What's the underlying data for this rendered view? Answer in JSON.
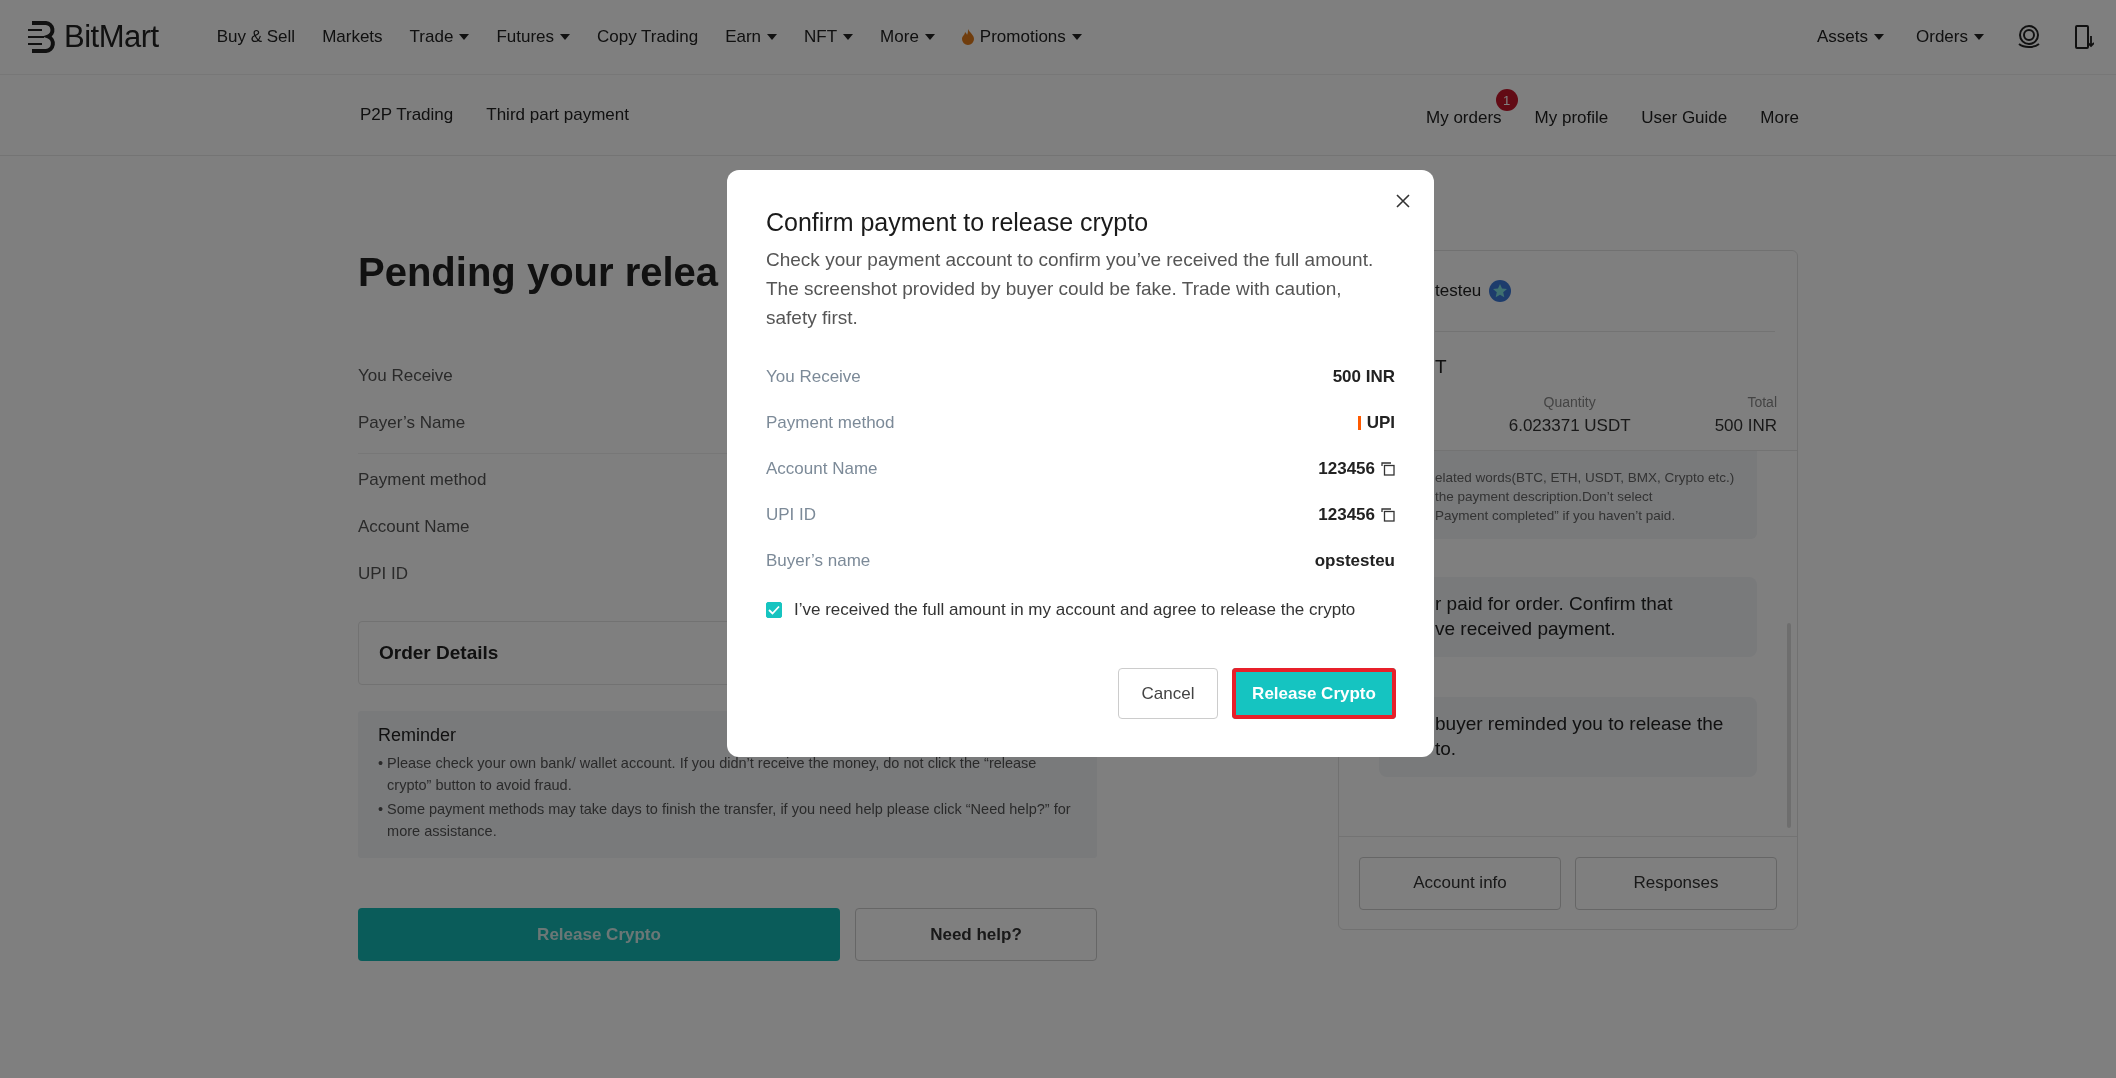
{
  "header": {
    "logo": "BitMart",
    "nav": [
      {
        "label": "Buy & Sell",
        "dropdown": false
      },
      {
        "label": "Markets",
        "dropdown": false
      },
      {
        "label": "Trade",
        "dropdown": true
      },
      {
        "label": "Futures",
        "dropdown": true
      },
      {
        "label": "Copy Trading",
        "dropdown": false
      },
      {
        "label": "Earn",
        "dropdown": true
      },
      {
        "label": "NFT",
        "dropdown": true
      },
      {
        "label": "More",
        "dropdown": true
      },
      {
        "label": "Promotions",
        "dropdown": true,
        "kind": "promo"
      }
    ],
    "right_nav": [
      {
        "label": "Assets",
        "dropdown": true
      },
      {
        "label": "Orders",
        "dropdown": true
      }
    ]
  },
  "subnav": {
    "left": [
      "P2P Trading",
      "Third part payment"
    ],
    "right": [
      {
        "label": "My orders",
        "badge": "1"
      },
      {
        "label": "My profile"
      },
      {
        "label": "User Guide"
      },
      {
        "label": "More"
      }
    ]
  },
  "page": {
    "title": "Pending your relea",
    "field_groups": [
      [
        "You Receive",
        "Payer’s Name"
      ],
      [
        "Payment method",
        "Account Name",
        "UPI ID"
      ]
    ],
    "order_details": "Order Details",
    "reminder": {
      "title": "Reminder",
      "bullet": "•",
      "items": [
        "Please check your own bank/ wallet account. If you didn’t receive the money, do not click the “release crypto” button to avoid fraud.",
        "Some payment methods may take days to finish the transfer, if you need help please click “Need help?” for more assistance."
      ]
    },
    "buttons": [
      {
        "label": "Release Crypto",
        "kind": "primary"
      },
      {
        "label": "Need help?",
        "kind": "secondary"
      }
    ]
  },
  "side_panel": {
    "user": "testeu",
    "ad_title": "T",
    "columns": [
      {
        "label": "Quantity",
        "value": "6.023371 USDT"
      },
      {
        "label": "Total",
        "value": "500 INR"
      }
    ],
    "notice_lines": [
      "elated words(BTC, ETH, USDT, BMX, Crypto etc.)",
      "the payment description.Don’t select",
      "Payment completed” if you haven’t paid."
    ],
    "messages": [
      {
        "lines": [
          "r paid for order. Confirm that",
          "ve received payment."
        ]
      },
      {
        "lines": [
          "buyer reminded you to release the",
          "to."
        ]
      }
    ],
    "buttons": [
      "Account info",
      "Responses"
    ]
  },
  "modal": {
    "title": "Confirm payment to release crypto",
    "description": "Check your payment account to confirm you’ve received the full amount. The screenshot provided by buyer could be fake. Trade with caution, safety first.",
    "rows": [
      {
        "label": "You Receive",
        "value": "500 INR",
        "kind": "plain"
      },
      {
        "label": "Payment method",
        "value": "UPI",
        "kind": "method"
      },
      {
        "label": "Account Name",
        "value": "123456",
        "kind": "copy"
      },
      {
        "label": "UPI ID",
        "value": "123456",
        "kind": "copy"
      },
      {
        "label": "Buyer’s name",
        "value": "opstesteu",
        "kind": "plain"
      }
    ],
    "agree": {
      "label": "I’ve received the full amount in my account and agree to release the crypto",
      "checked": true
    },
    "buttons": [
      {
        "label": "Cancel",
        "kind": "secondary",
        "highlighted": false
      },
      {
        "label": "Release Crypto",
        "kind": "primary",
        "highlighted": true
      }
    ]
  }
}
